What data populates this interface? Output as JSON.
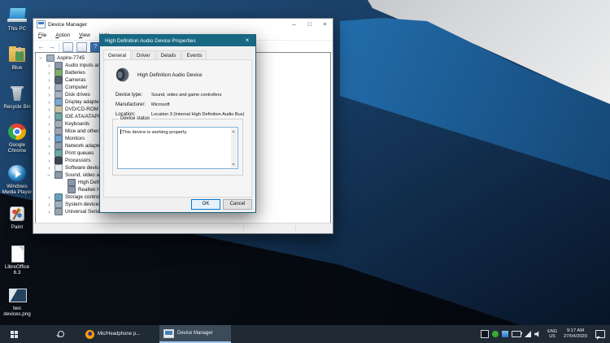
{
  "desktop": {
    "icons": [
      {
        "label": "This PC"
      },
      {
        "label": "Blue"
      },
      {
        "label": "Recycle Bin"
      },
      {
        "label": "Google Chrome"
      },
      {
        "label": "Windows Media Player"
      },
      {
        "label": "Paint"
      },
      {
        "label": "LibreOffice 6.3"
      },
      {
        "label": "two devices.png"
      }
    ]
  },
  "device_manager_window": {
    "title": "Device Manager",
    "window_controls": {
      "minimize": "–",
      "maximize": "□",
      "close": "×"
    },
    "menu": [
      {
        "label": "File"
      },
      {
        "label": "Action"
      },
      {
        "label": "View"
      },
      {
        "label": "Help"
      }
    ],
    "tree": [
      {
        "label": "Aspire-7745",
        "level": 0,
        "expanded": true
      },
      {
        "label": "Audio inputs and outputs",
        "level": 1
      },
      {
        "label": "Batteries",
        "level": 1
      },
      {
        "label": "Cameras",
        "level": 1
      },
      {
        "label": "Computer",
        "level": 1
      },
      {
        "label": "Disk drives",
        "level": 1
      },
      {
        "label": "Display adapters",
        "level": 1
      },
      {
        "label": "DVD/CD-ROM drives",
        "level": 1
      },
      {
        "label": "IDE ATA/ATAPI controllers",
        "level": 1
      },
      {
        "label": "Keyboards",
        "level": 1
      },
      {
        "label": "Mice and other pointing devices",
        "level": 1
      },
      {
        "label": "Monitors",
        "level": 1
      },
      {
        "label": "Network adapters",
        "level": 1
      },
      {
        "label": "Print queues",
        "level": 1
      },
      {
        "label": "Processors",
        "level": 1
      },
      {
        "label": "Software devices",
        "level": 1
      },
      {
        "label": "Sound, video and game controllers",
        "level": 1,
        "expanded": true
      },
      {
        "label": "High Definition Audio Device",
        "level": 2
      },
      {
        "label": "Realtek High Definition Audio",
        "level": 2
      },
      {
        "label": "Storage controllers",
        "level": 1
      },
      {
        "label": "System devices",
        "level": 1
      },
      {
        "label": "Universal Serial Bus controllers",
        "level": 1
      }
    ]
  },
  "properties_dialog": {
    "title": "High Definition Audio Device Properties",
    "close": "×",
    "accent_color": "#176883",
    "tabs": [
      {
        "label": "General",
        "active": true
      },
      {
        "label": "Driver",
        "active": false
      },
      {
        "label": "Details",
        "active": false
      },
      {
        "label": "Events",
        "active": false
      }
    ],
    "device_name": "High Definition Audio Device",
    "fields": [
      {
        "label": "Device type:",
        "value": "Sound, video and game controllers"
      },
      {
        "label": "Manufacturer:",
        "value": "Microsoft"
      },
      {
        "label": "Location:",
        "value": "Location 3 (Internal High Definition Audio Bus)"
      }
    ],
    "device_status_label": "Device status",
    "device_status_text": "This device is working properly.",
    "buttons": {
      "ok": "OK",
      "cancel": "Cancel"
    }
  },
  "taskbar": {
    "active_accent": "#9cc7ee",
    "tasks": [
      {
        "label": "Mic/Headphone p...",
        "active": false
      },
      {
        "label": "Device Manager",
        "active": true
      }
    ],
    "tray": {
      "language": "ENG",
      "region": "US",
      "time": "9:17 AM",
      "date": "27/04/2020"
    }
  }
}
